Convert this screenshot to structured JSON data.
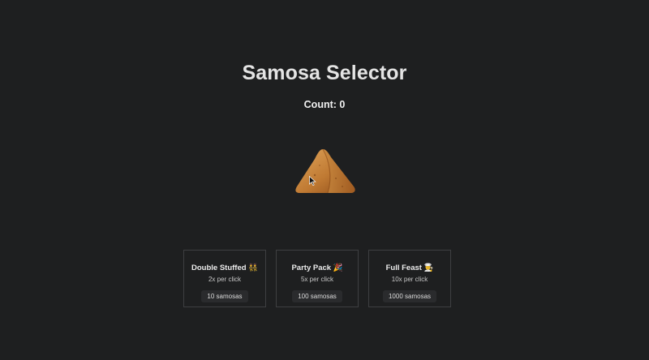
{
  "app": {
    "title": "Samosa Selector",
    "count_label": "Count: 0"
  },
  "samosa": {
    "icon": "samosa-icon",
    "colors": {
      "light": "#d99a4e",
      "mid": "#b36a26",
      "dark": "#7a3f12"
    }
  },
  "upgrades": [
    {
      "title": "Double Stuffed 👯",
      "rate": "2x per click",
      "cost": "10 samosas"
    },
    {
      "title": "Party Pack 🎉",
      "rate": "5x per click",
      "cost": "100 samosas"
    },
    {
      "title": "Full Feast 👨‍🍳",
      "rate": "10x per click",
      "cost": "1000 samosas"
    }
  ]
}
